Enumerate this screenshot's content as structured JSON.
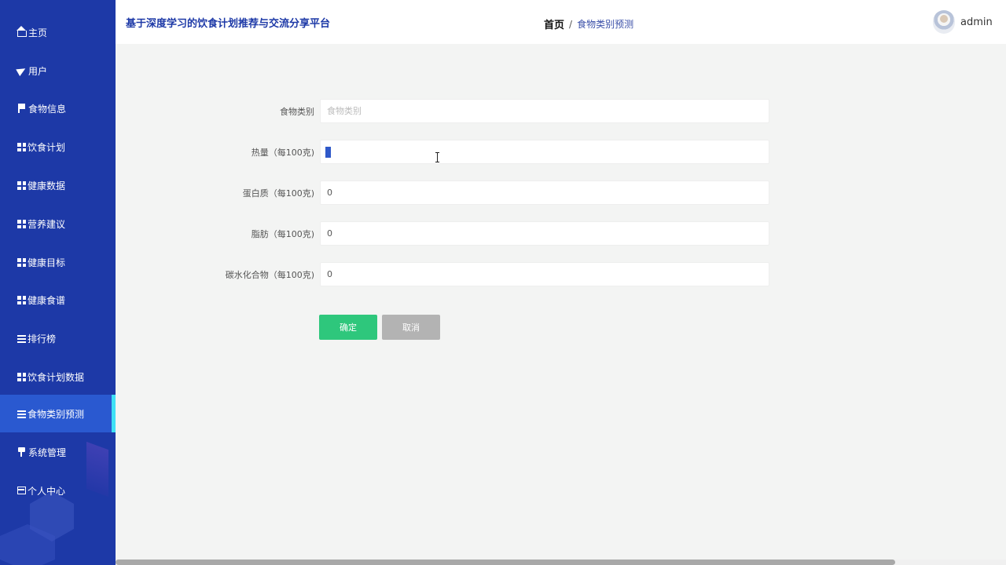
{
  "app": {
    "title": "基于深度学习的饮食计划推荐与交流分享平台"
  },
  "breadcrumb": {
    "home": "首页",
    "separator": "/",
    "current": "食物类别预测"
  },
  "user": {
    "name": "admin",
    "avatar_icon": "avatar-icon"
  },
  "sidebar": {
    "items": [
      {
        "label": "主页",
        "icon": "home-icon"
      },
      {
        "label": "用户",
        "icon": "paper-plane-icon"
      },
      {
        "label": "食物信息",
        "icon": "flag-icon"
      },
      {
        "label": "饮食计划",
        "icon": "grid-icon"
      },
      {
        "label": "健康数据",
        "icon": "grid-icon"
      },
      {
        "label": "营养建议",
        "icon": "grid-icon"
      },
      {
        "label": "健康目标",
        "icon": "grid-icon"
      },
      {
        "label": "健康食谱",
        "icon": "grid-icon"
      },
      {
        "label": "排行榜",
        "icon": "list-icon"
      },
      {
        "label": "饮食计划数据",
        "icon": "grid-icon"
      },
      {
        "label": "食物类别预测",
        "icon": "list-icon",
        "active": true
      },
      {
        "label": "系统管理",
        "icon": "pin-icon"
      },
      {
        "label": "个人中心",
        "icon": "window-icon"
      }
    ],
    "active_index": 10
  },
  "form": {
    "fields": [
      {
        "label": "食物类别",
        "value": "",
        "placeholder": "食物类别"
      },
      {
        "label": "热量（每100克)",
        "value": "0",
        "placeholder": ""
      },
      {
        "label": "蛋白质（每100克)",
        "value": "0",
        "placeholder": ""
      },
      {
        "label": "脂肪（每100克)",
        "value": "0",
        "placeholder": ""
      },
      {
        "label": "碳水化合物（每100克)",
        "value": "0",
        "placeholder": ""
      }
    ],
    "confirm_label": "确定",
    "cancel_label": "取消"
  },
  "colors": {
    "sidebar_bg": "#1d39a7",
    "sidebar_active": "#2a59d0",
    "active_indicator": "#3ee0f5",
    "title_color": "#1d39a7",
    "confirm_button": "#2ec77c",
    "cancel_button": "#b3b3b3"
  }
}
